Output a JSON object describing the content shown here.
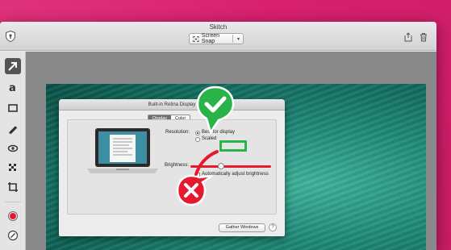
{
  "window": {
    "title": "Skitch"
  },
  "toolbar": {
    "mode_label": "Screen Snap"
  },
  "dialog": {
    "title": "Built-in Retina Display",
    "tabs": [
      {
        "label": "Display",
        "selected": true
      },
      {
        "label": "Color",
        "selected": false
      }
    ],
    "resolution_label": "Resolution:",
    "resolution_options": [
      {
        "label": "Best for display",
        "selected": true
      },
      {
        "label": "Scaled",
        "selected": false
      }
    ],
    "brightness_label": "Brightness:",
    "brightness_level": 0.38,
    "auto_brightness_label": "Automatically adjust brightness",
    "auto_brightness_checked": false,
    "gather_button_label": "Gather Windows",
    "help_label": "?"
  },
  "annotations": {
    "check_color": "#29b349",
    "cross_color": "#e51a2d",
    "arrow_color": "#e51a2d"
  },
  "colors": {
    "accent_swatch": "#e51a2d",
    "background": "#d8206f"
  },
  "icons": {
    "sidebar_tools": [
      "arrow-tool-icon",
      "text-tool-icon",
      "rectangle-tool-icon",
      "marker-tool-icon",
      "highlighter-tool-icon",
      "pixelate-tool-icon",
      "crop-tool-icon",
      "color-swatch-icon",
      "size-tool-icon"
    ],
    "titlebar": [
      "shield-icon",
      "share-icon",
      "trash-icon"
    ]
  }
}
